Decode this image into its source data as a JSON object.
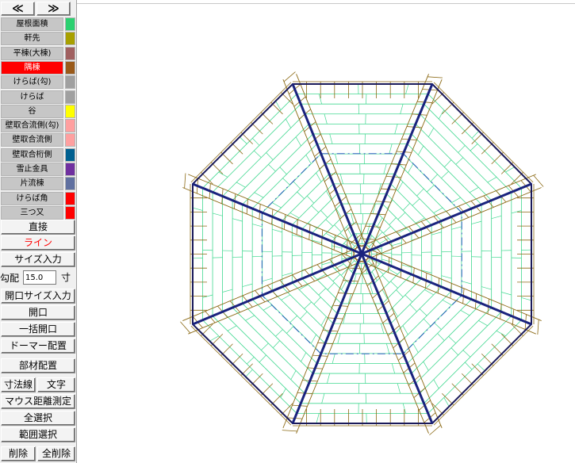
{
  "nav": {
    "prev_label": "≪",
    "next_label": "≫"
  },
  "layers": [
    {
      "label": "屋根面積",
      "color": "#2bd070"
    },
    {
      "label": "軒先",
      "color": "#a8a000"
    },
    {
      "label": "平棟(大棟)",
      "color": "#a06060"
    },
    {
      "label": "隅棟",
      "color": "#9a5a1a",
      "active": true
    },
    {
      "label": "けらば(勾)",
      "color": "#a0a0a0"
    },
    {
      "label": "けらば",
      "color": "#a0a0a0"
    },
    {
      "label": "谷",
      "color": "#ffff00"
    },
    {
      "label": "壁取合流側(勾)",
      "color": "#ffa0a0"
    },
    {
      "label": "壁取合流側",
      "color": "#ffa0a0"
    },
    {
      "label": "壁取合桁側",
      "color": "#006090"
    },
    {
      "label": "雪止金具",
      "color": "#7030a0"
    },
    {
      "label": "片流棟",
      "color": "#6070a0"
    },
    {
      "label": "けらば角",
      "color": "#ff0000"
    },
    {
      "label": "三つ又",
      "color": "#ff0000"
    }
  ],
  "commands": {
    "direct": "直接",
    "line": "ライン",
    "size_input": "サイズ入力",
    "pitch_label": "勾配",
    "pitch_value": "15.0",
    "pitch_unit": "寸",
    "opening_size_input": "開口サイズ入力",
    "opening": "開口",
    "bulk_opening": "一括開口",
    "dormer_place": "ドーマー配置",
    "member_place": "部材配置",
    "dimension_line": "寸法線",
    "text": "文字",
    "mouse_distance": "マウス距離測定",
    "select_all": "全選択",
    "range_select": "範囲選択",
    "delete": "削除",
    "delete_all": "全削除"
  },
  "colors": {
    "outline": "#1a1a5a",
    "hip_line": "#1a237e",
    "hip_band": "#8b6914",
    "roof_lines": "#40d890",
    "inner_dash": "#3060c0"
  }
}
